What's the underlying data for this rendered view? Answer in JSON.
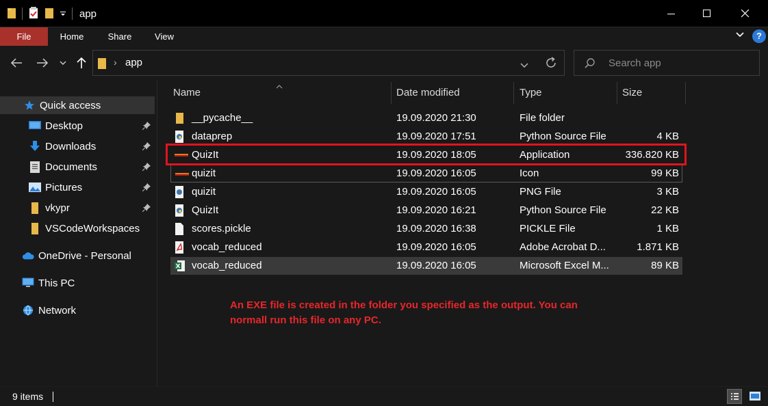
{
  "window": {
    "title": "app"
  },
  "ribbon": {
    "tabs": [
      "File",
      "Home",
      "Share",
      "View"
    ],
    "help_label": "?"
  },
  "address": {
    "path": "app",
    "search_placeholder": "Search app"
  },
  "sidebar": {
    "quick_access": "Quick access",
    "items": [
      {
        "label": "Desktop",
        "icon": "desktop-icon",
        "pinned": true
      },
      {
        "label": "Downloads",
        "icon": "downloads-icon",
        "pinned": true
      },
      {
        "label": "Documents",
        "icon": "documents-icon",
        "pinned": true
      },
      {
        "label": "Pictures",
        "icon": "pictures-icon",
        "pinned": true
      },
      {
        "label": "vkypr",
        "icon": "folder-icon",
        "pinned": true
      },
      {
        "label": "VSCodeWorkspaces",
        "icon": "folder-icon",
        "pinned": false
      }
    ],
    "onedrive": "OneDrive - Personal",
    "this_pc": "This PC",
    "network": "Network"
  },
  "columns": {
    "name": "Name",
    "date": "Date modified",
    "type": "Type",
    "size": "Size"
  },
  "files": [
    {
      "name": "__pycache__",
      "date": "19.09.2020 21:30",
      "type": "File folder",
      "size": "",
      "icon": "folder-icon"
    },
    {
      "name": "dataprep",
      "date": "19.09.2020 17:51",
      "type": "Python Source File",
      "size": "4 KB",
      "icon": "python-file-icon"
    },
    {
      "name": "QuizIt",
      "date": "19.09.2020 18:05",
      "type": "Application",
      "size": "336.820 KB",
      "icon": "application-icon"
    },
    {
      "name": "quizit",
      "date": "19.09.2020 16:05",
      "type": "Icon",
      "size": "99 KB",
      "icon": "ico-file-icon"
    },
    {
      "name": "quizit",
      "date": "19.09.2020 16:05",
      "type": "PNG File",
      "size": "3 KB",
      "icon": "png-file-icon"
    },
    {
      "name": "QuizIt",
      "date": "19.09.2020 16:21",
      "type": "Python Source File",
      "size": "22 KB",
      "icon": "python-file-icon"
    },
    {
      "name": "scores.pickle",
      "date": "19.09.2020 16:38",
      "type": "PICKLE File",
      "size": "1 KB",
      "icon": "blank-file-icon"
    },
    {
      "name": "vocab_reduced",
      "date": "19.09.2020 16:05",
      "type": "Adobe Acrobat D...",
      "size": "1.871 KB",
      "icon": "pdf-file-icon"
    },
    {
      "name": "vocab_reduced",
      "date": "19.09.2020 16:05",
      "type": "Microsoft Excel M...",
      "size": "89 KB",
      "icon": "excel-file-icon"
    }
  ],
  "annotation": "An EXE file is created in the folder you specified as the output. You can normall run this file on any PC.",
  "status": {
    "item_count": "9 items"
  },
  "colors": {
    "accent_file_tab": "#a8312b",
    "highlight_border": "#e0141e",
    "annotation_text": "#e8262b"
  }
}
